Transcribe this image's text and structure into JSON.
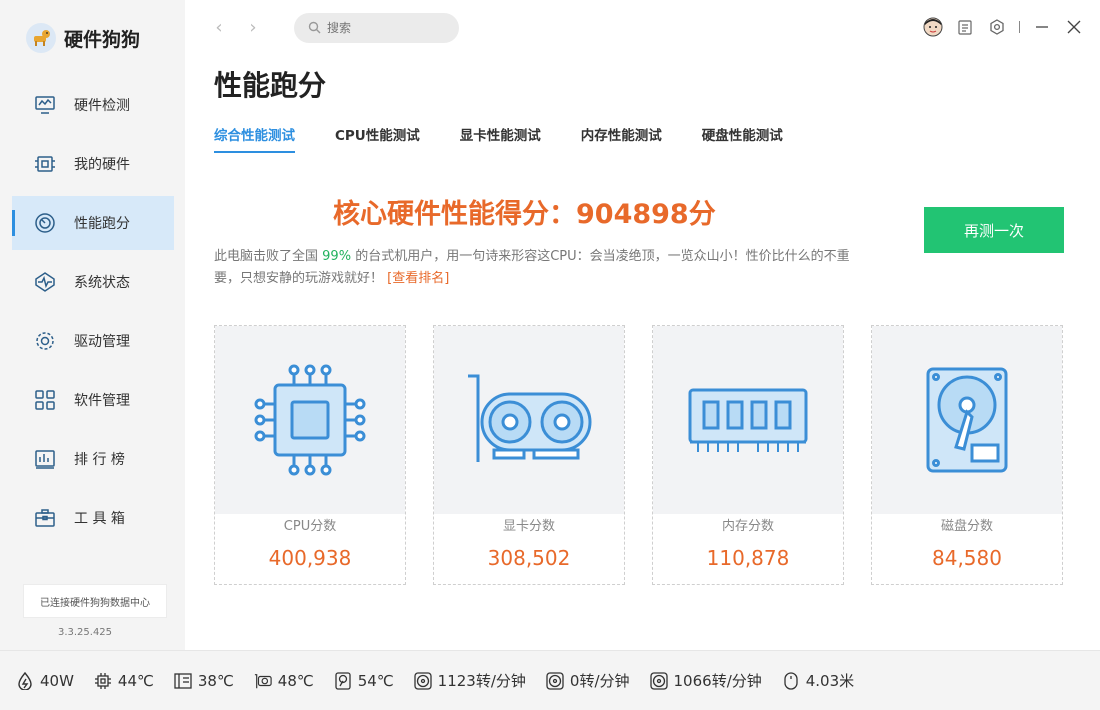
{
  "app": {
    "name": "硬件狗狗",
    "version": "3.3.25.425",
    "status_text": "已连接硬件狗狗数据中心"
  },
  "sidebar": {
    "items": [
      {
        "label": "硬件检测",
        "icon": "monitor-icon"
      },
      {
        "label": "我的硬件",
        "icon": "chip-icon"
      },
      {
        "label": "性能跑分",
        "icon": "speedometer-icon",
        "active": true
      },
      {
        "label": "系统状态",
        "icon": "pulse-icon"
      },
      {
        "label": "驱动管理",
        "icon": "gear-icon"
      },
      {
        "label": "软件管理",
        "icon": "grid-icon"
      },
      {
        "label": "排 行 榜",
        "icon": "chart-icon"
      },
      {
        "label": "工 具 箱",
        "icon": "toolbox-icon"
      }
    ]
  },
  "topbar": {
    "search_placeholder": "搜索"
  },
  "page": {
    "title": "性能跑分",
    "tabs": [
      "综合性能测试",
      "CPU性能测试",
      "显卡性能测试",
      "内存性能测试",
      "硬盘性能测试"
    ],
    "active_tab": 0,
    "score_label": "核心硬件性能得分：",
    "score_value": "904898分",
    "retest_label": "再测一次",
    "desc_prefix": "此电脑击败了全国",
    "desc_percent": "99%",
    "desc_suffix": "的台式机用户，用一句诗来形容这CPU：会当凌绝顶，一览众山小！性价比什么的不重要，只想安静的玩游戏就好！",
    "rank_link": "[查看排名]"
  },
  "cards": [
    {
      "label": "CPU分数",
      "value": "400,938",
      "icon": "cpu-icon"
    },
    {
      "label": "显卡分数",
      "value": "308,502",
      "icon": "gpu-icon"
    },
    {
      "label": "内存分数",
      "value": "110,878",
      "icon": "ram-icon"
    },
    {
      "label": "磁盘分数",
      "value": "84,580",
      "icon": "hdd-icon"
    }
  ],
  "statusbar": [
    {
      "icon": "power-icon",
      "value": "40W"
    },
    {
      "icon": "cpu-temp-icon",
      "value": "44℃"
    },
    {
      "icon": "board-temp-icon",
      "value": "38℃"
    },
    {
      "icon": "gpu-temp-icon",
      "value": "48℃"
    },
    {
      "icon": "disk-temp-icon",
      "value": "54℃"
    },
    {
      "icon": "fan-icon",
      "value": "1123转/分钟"
    },
    {
      "icon": "fan-icon",
      "value": "0转/分钟"
    },
    {
      "icon": "fan-icon",
      "value": "1066转/分钟"
    },
    {
      "icon": "mouse-icon",
      "value": "4.03米"
    }
  ],
  "colors": {
    "accent": "#2d8fe0",
    "score": "#e8692a",
    "button": "#22c473",
    "percent": "#22b25e"
  }
}
